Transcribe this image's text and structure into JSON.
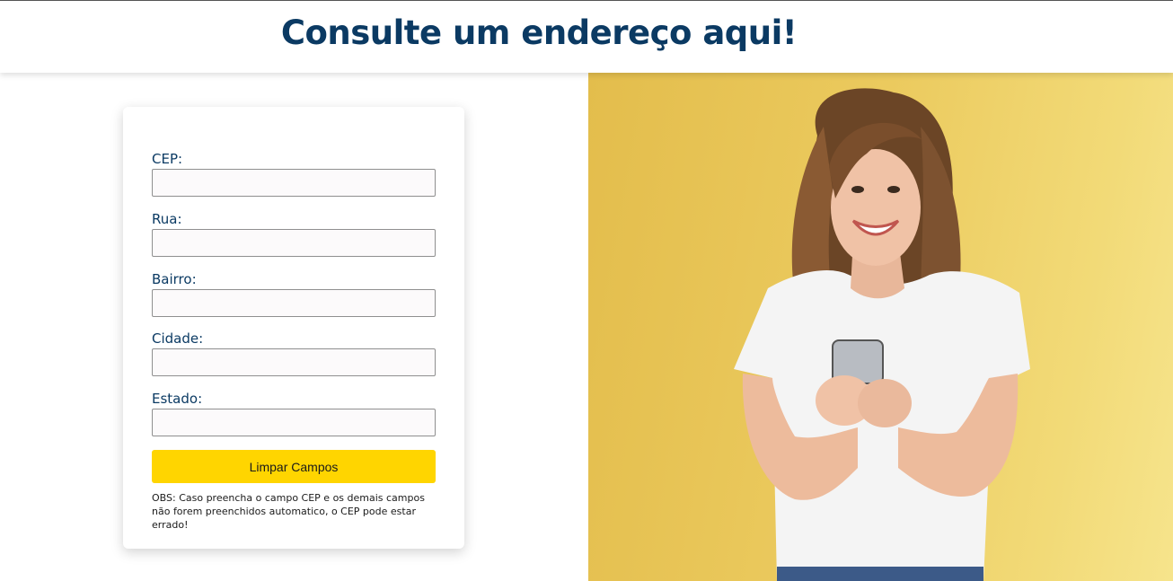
{
  "header": {
    "title": "Consulte um endereço aqui!"
  },
  "form": {
    "fields": [
      {
        "label": "CEP:",
        "value": "",
        "placeholder": ""
      },
      {
        "label": "Rua:",
        "value": "",
        "placeholder": ""
      },
      {
        "label": "Bairro:",
        "value": "",
        "placeholder": ""
      },
      {
        "label": "Cidade:",
        "value": "",
        "placeholder": ""
      },
      {
        "label": "Estado:",
        "value": "",
        "placeholder": ""
      }
    ],
    "clear_button_label": "Limpar Campos",
    "note": "OBS: Caso preencha o campo CEP e os demais campos não forem preenchidos automatico, o CEP pode estar errado!"
  },
  "colors": {
    "title": "#0b3a63",
    "button": "#ffd500",
    "photo_background": "#ebca5e"
  },
  "image": {
    "subject": "smiling woman holding smartphone"
  }
}
